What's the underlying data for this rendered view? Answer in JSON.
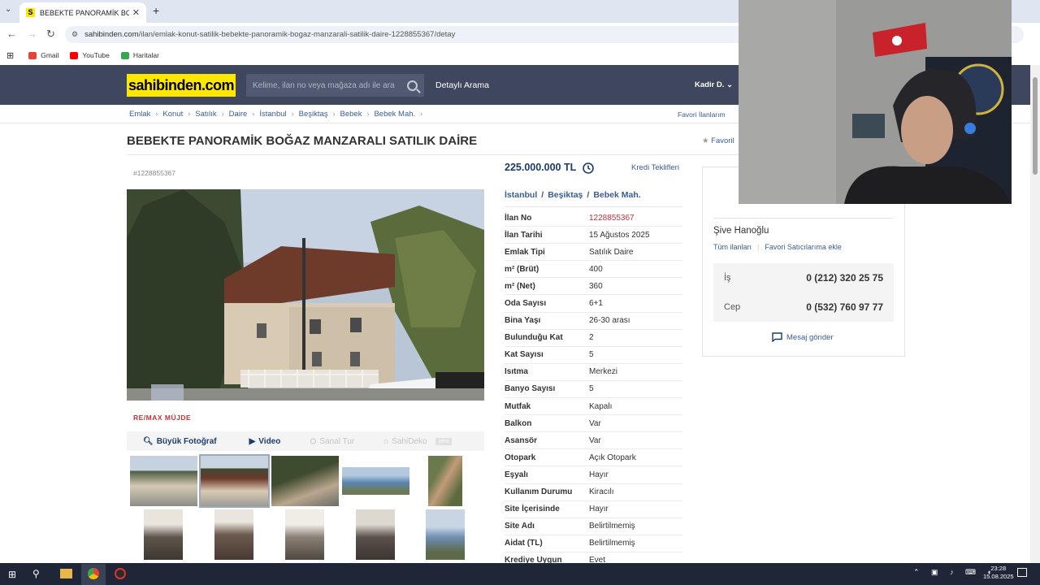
{
  "browser": {
    "tab_title": "BEBEKTE PANORAMİK BOĞAZ M",
    "url_host": "sahibinden.com",
    "url_path": "/ilan/emlak-konut-satilik-bebekte-panoramik-bogaz-manzarali-satilik-daire-1228855367/detay",
    "bookmarks": [
      "Gmail",
      "YouTube",
      "Haritalar"
    ]
  },
  "header": {
    "logo": "sahibinden.com",
    "search_placeholder": "Kelime, ilan no veya mağaza adı ile ara",
    "detailed_search": "Detaylı Arama",
    "user": "Kadir D."
  },
  "breadcrumb": [
    "Emlak",
    "Konut",
    "Satılık",
    "Daire",
    "İstanbul",
    "Beşiktaş",
    "Bebek",
    "Bebek Mah."
  ],
  "favorite_listings": "Favori İlanlarım",
  "listing": {
    "title": "BEBEKTE PANORAMİK BOĞAZ MANZARALI SATILIK DAİRE",
    "favorite_link": "Favoril",
    "number": "#1228855367",
    "agency": "RE/MAX MÜJDE",
    "price": "225.000.000 TL",
    "loan_offers": "Kredi Teklifleri",
    "location": [
      "İstanbul",
      "Beşiktaş",
      "Bebek Mah."
    ],
    "photo_buttons": {
      "big_photo": "Büyük Fotoğraf",
      "video": "Video",
      "virtual_tour": "Sanal Tur",
      "sahideko": "SahiDeko",
      "new_badge": "yeni"
    },
    "details": [
      {
        "k": "İlan No",
        "v": "1228855367"
      },
      {
        "k": "İlan Tarihi",
        "v": "15 Ağustos 2025"
      },
      {
        "k": "Emlak Tipi",
        "v": "Satılık Daire"
      },
      {
        "k": "m² (Brüt)",
        "v": "400"
      },
      {
        "k": "m² (Net)",
        "v": "360"
      },
      {
        "k": "Oda Sayısı",
        "v": "6+1"
      },
      {
        "k": "Bina Yaşı",
        "v": "26-30 arası"
      },
      {
        "k": "Bulunduğu Kat",
        "v": "2"
      },
      {
        "k": "Kat Sayısı",
        "v": "5"
      },
      {
        "k": "Isıtma",
        "v": "Merkezi"
      },
      {
        "k": "Banyo Sayısı",
        "v": "5"
      },
      {
        "k": "Mutfak",
        "v": "Kapalı"
      },
      {
        "k": "Balkon",
        "v": "Var"
      },
      {
        "k": "Asansör",
        "v": "Var"
      },
      {
        "k": "Otopark",
        "v": "Açık Otopark"
      },
      {
        "k": "Eşyalı",
        "v": "Hayır"
      },
      {
        "k": "Kullanım Durumu",
        "v": "Kiracılı"
      },
      {
        "k": "Site İçerisinde",
        "v": "Hayır"
      },
      {
        "k": "Site Adı",
        "v": "Belirtilmemiş"
      },
      {
        "k": "Aidat (TL)",
        "v": "Belirtilmemiş"
      },
      {
        "k": "Krediye Uygun",
        "v": "Evet"
      }
    ]
  },
  "seller": {
    "agency": "RE/MAX MÜJDE",
    "name": "Şive Hanoğlu",
    "all_listings": "Tüm ilanları",
    "add_favorite": "Favori Satıcılarıma ekle",
    "work_label": "İş",
    "work_phone": "0 (212) 320 25 75",
    "mobile_label": "Cep",
    "mobile_phone": "0 (532) 760 97 77",
    "send_message": "Mesaj gönder"
  },
  "taskbar": {
    "time": "23:28",
    "date": "15.08.2025"
  },
  "colors": {
    "header_bg": "#3f475f",
    "logo_yellow": "#ffe800",
    "link_blue": "#3a5c97",
    "red": "#c0333a"
  }
}
